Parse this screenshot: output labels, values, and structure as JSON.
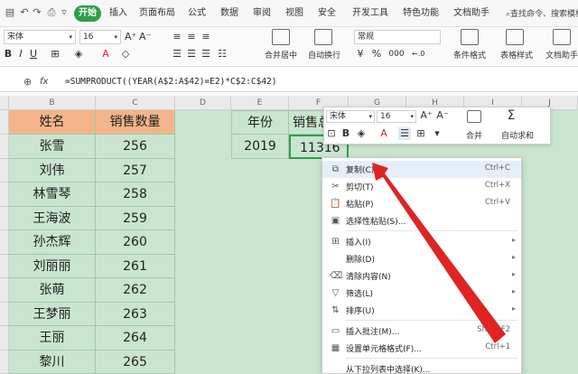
{
  "menu": {
    "tabs": [
      "开始",
      "插入",
      "页面布局",
      "公式",
      "数据",
      "审阅",
      "视图",
      "安全",
      "开发工具",
      "特色功能",
      "文档助手"
    ],
    "search": "查找命令、搜索模板"
  },
  "ribbon": {
    "font_name": "宋体",
    "font_size": "16",
    "number_format": "常规",
    "merge_label": "合并居中",
    "wrap_label": "自动换行",
    "cond_format_label": "条件格式",
    "table_style_label": "表格样式",
    "doc_helper_label": "文档助手",
    "percent": "%",
    "thousands": "000"
  },
  "formula_bar": {
    "fx": "fx",
    "formula": "=SUMPRODUCT((YEAR(A$2:A$42)=E2)*C$2:C$42)"
  },
  "sheet": {
    "columns": [
      "B",
      "C",
      "D",
      "E",
      "F",
      "G",
      "H",
      "I",
      "J"
    ],
    "header": {
      "name": "姓名",
      "qty": "销售数量",
      "year": "年份",
      "sales": "销售总"
    },
    "rows": [
      {
        "name": "张雪",
        "qty": "256"
      },
      {
        "name": "刘伟",
        "qty": "257"
      },
      {
        "name": "林雪琴",
        "qty": "258"
      },
      {
        "name": "王海波",
        "qty": "259"
      },
      {
        "name": "孙杰辉",
        "qty": "260"
      },
      {
        "name": "刘丽丽",
        "qty": "261"
      },
      {
        "name": "张萌",
        "qty": "262"
      },
      {
        "name": "王梦丽",
        "qty": "263"
      },
      {
        "name": "王丽",
        "qty": "264"
      },
      {
        "name": "黎川",
        "qty": "265"
      }
    ],
    "e2": "2019",
    "f2": "11316"
  },
  "mini_toolbar": {
    "font_name": "宋体",
    "font_size": "16",
    "merge": "合并",
    "autosum": "自动求和"
  },
  "context_menu": {
    "items": [
      {
        "label": "复制(C)",
        "shortcut": "Ctrl+C",
        "icon": "copy-icon"
      },
      {
        "label": "剪切(T)",
        "shortcut": "Ctrl+X",
        "icon": "scissors-icon"
      },
      {
        "label": "粘贴(P)",
        "shortcut": "Ctrl+V",
        "icon": "paste-icon"
      },
      {
        "label": "选择性粘贴(S)...",
        "shortcut": "",
        "icon": "paste-special-icon"
      },
      {
        "label": "插入(I)",
        "shortcut": "",
        "icon": "insert-icon"
      },
      {
        "label": "删除(D)",
        "shortcut": "",
        "icon": ""
      },
      {
        "label": "清除内容(N)",
        "shortcut": "",
        "icon": "eraser-icon"
      },
      {
        "label": "筛选(L)",
        "shortcut": "",
        "icon": "filter-icon"
      },
      {
        "label": "排序(U)",
        "shortcut": "",
        "icon": "sort-icon"
      },
      {
        "label": "插入批注(M)...",
        "shortcut": "Shift+F2",
        "icon": "comment-icon"
      },
      {
        "label": "设置单元格格式(F)...",
        "shortcut": "Ctrl+1",
        "icon": "format-cells-icon"
      },
      {
        "label": "从下拉列表中选择(K)...",
        "shortcut": "",
        "icon": ""
      }
    ]
  },
  "colors": {
    "accent_green": "#2e9e49",
    "header_orange": "#f3b48b",
    "sheet_green": "#c9e5cf",
    "arrow_red": "#e02424"
  }
}
